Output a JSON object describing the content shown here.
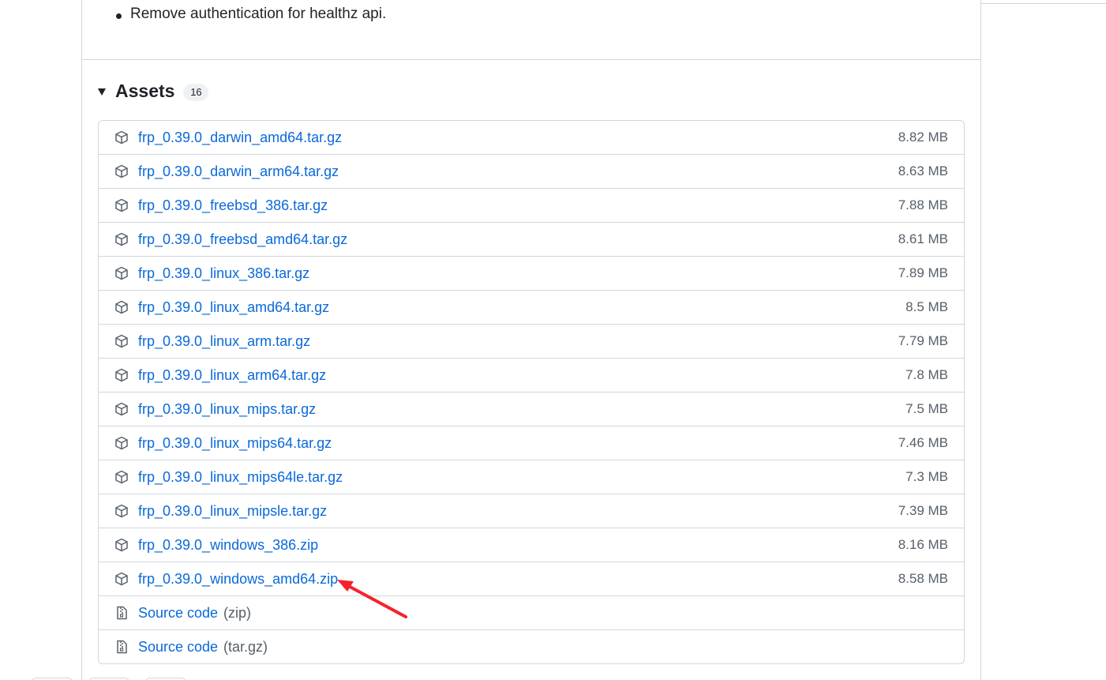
{
  "notes": {
    "bullet_text": "Remove authentication for healthz api."
  },
  "assets": {
    "title": "Assets",
    "count": "16",
    "items": [
      {
        "name": "frp_0.39.0_darwin_amd64.tar.gz",
        "size": "8.82 MB",
        "icon": "package-icon"
      },
      {
        "name": "frp_0.39.0_darwin_arm64.tar.gz",
        "size": "8.63 MB",
        "icon": "package-icon"
      },
      {
        "name": "frp_0.39.0_freebsd_386.tar.gz",
        "size": "7.88 MB",
        "icon": "package-icon"
      },
      {
        "name": "frp_0.39.0_freebsd_amd64.tar.gz",
        "size": "8.61 MB",
        "icon": "package-icon"
      },
      {
        "name": "frp_0.39.0_linux_386.tar.gz",
        "size": "7.89 MB",
        "icon": "package-icon"
      },
      {
        "name": "frp_0.39.0_linux_amd64.tar.gz",
        "size": "8.5 MB",
        "icon": "package-icon"
      },
      {
        "name": "frp_0.39.0_linux_arm.tar.gz",
        "size": "7.79 MB",
        "icon": "package-icon"
      },
      {
        "name": "frp_0.39.0_linux_arm64.tar.gz",
        "size": "7.8 MB",
        "icon": "package-icon"
      },
      {
        "name": "frp_0.39.0_linux_mips.tar.gz",
        "size": "7.5 MB",
        "icon": "package-icon"
      },
      {
        "name": "frp_0.39.0_linux_mips64.tar.gz",
        "size": "7.46 MB",
        "icon": "package-icon"
      },
      {
        "name": "frp_0.39.0_linux_mips64le.tar.gz",
        "size": "7.3 MB",
        "icon": "package-icon"
      },
      {
        "name": "frp_0.39.0_linux_mipsle.tar.gz",
        "size": "7.39 MB",
        "icon": "package-icon"
      },
      {
        "name": "frp_0.39.0_windows_386.zip",
        "size": "8.16 MB",
        "icon": "package-icon"
      },
      {
        "name": "frp_0.39.0_windows_amd64.zip",
        "size": "8.58 MB",
        "icon": "package-icon"
      }
    ],
    "source": [
      {
        "label": "Source code",
        "suffix": "(zip)",
        "icon": "file-zip-icon"
      },
      {
        "label": "Source code",
        "suffix": "(tar.gz)",
        "icon": "file-zip-icon"
      }
    ]
  },
  "colors": {
    "link": "#0969da",
    "muted": "#57606a",
    "border": "#d0d7de",
    "annotation": "#f5222d"
  }
}
